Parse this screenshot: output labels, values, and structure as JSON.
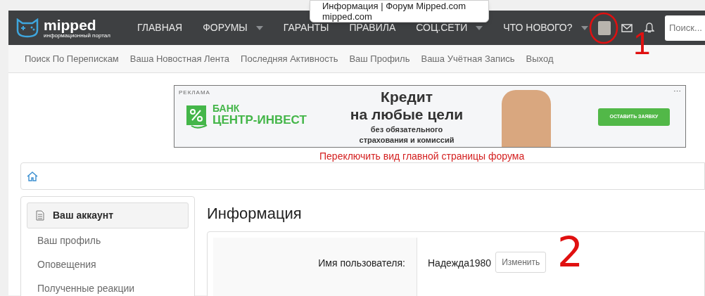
{
  "tooltip": {
    "title": "Информация | Форум Mipped.com",
    "url": "mipped.com"
  },
  "logo": {
    "name": "mipped",
    "tagline": "информационный портал"
  },
  "nav": [
    {
      "label": "ГЛАВНАЯ",
      "dropdown": false
    },
    {
      "label": "ФОРУМЫ",
      "dropdown": true
    },
    {
      "label": "ГАРАНТЫ",
      "dropdown": false
    },
    {
      "label": "ПРАВИЛА",
      "dropdown": false
    },
    {
      "label": "СОЦ.СЕТИ",
      "dropdown": true
    },
    {
      "label": "ЧТО НОВОГО?",
      "dropdown": true
    }
  ],
  "search": {
    "placeholder": "Поиск..."
  },
  "subnav": [
    "Поиск По Перепискам",
    "Ваша Новостная Лента",
    "Последняя Активность",
    "Ваш Профиль",
    "Ваша Учётная Запись",
    "Выход"
  ],
  "ad": {
    "label": "РЕКЛАМА",
    "menu": "⋯",
    "bank_line1": "БАНК",
    "bank_line2": "ЦЕНТР-ИНВЕСТ",
    "headline1": "Кредит",
    "headline2": "на любые цели",
    "subline1": "без обязательного",
    "subline2": "страхования и комиссий",
    "button": "ОСТАВИТЬ ЗАЯВКУ"
  },
  "switch_link": "Переключить вид главной страницы форума",
  "sidebar": {
    "items": [
      {
        "label": "Ваш аккаунт",
        "kind": "header",
        "selected": true
      },
      {
        "label": "Ваш профиль",
        "kind": "link",
        "selected": false
      },
      {
        "label": "Оповещения",
        "kind": "link",
        "selected": false
      },
      {
        "label": "Полученные реакции",
        "kind": "link",
        "selected": false
      }
    ]
  },
  "page_title": "Информация",
  "form": {
    "rows": [
      {
        "label": "Имя пользователя:",
        "value": "Надежда1980",
        "button": "Изменить"
      }
    ]
  },
  "annotations": [
    "1",
    "2"
  ]
}
